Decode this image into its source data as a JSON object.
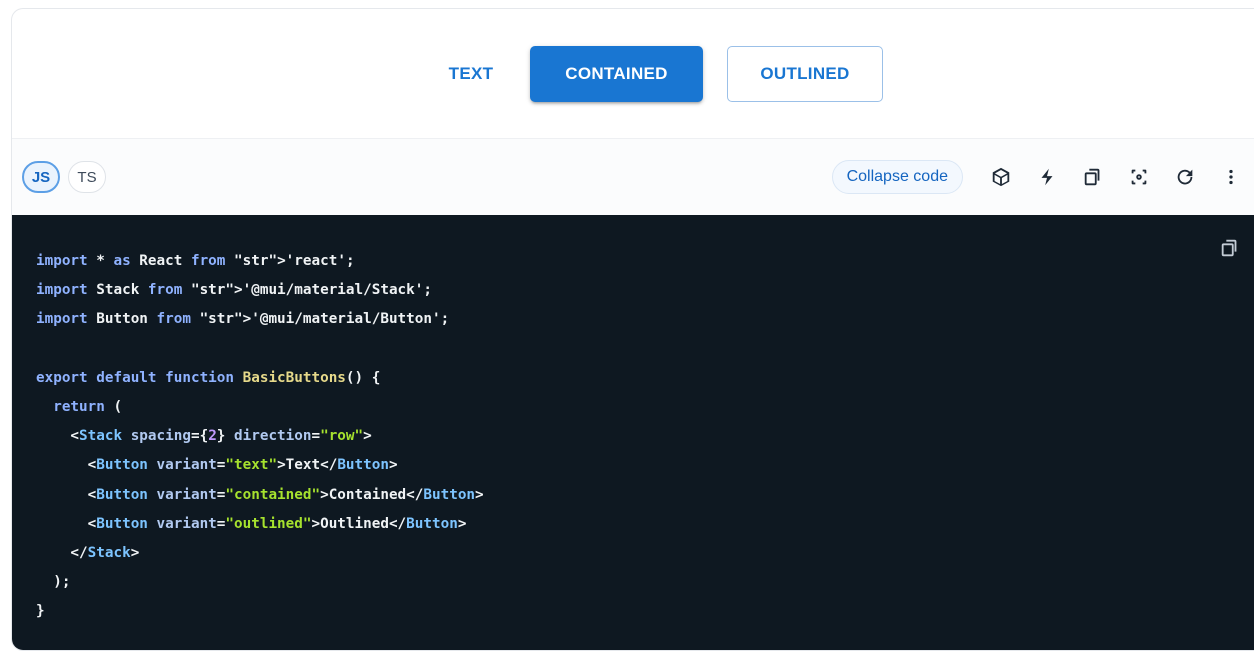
{
  "demo": {
    "buttons": [
      {
        "label": "Text"
      },
      {
        "label": "Contained"
      },
      {
        "label": "Outlined"
      }
    ]
  },
  "toolbar": {
    "languages": [
      "JS",
      "TS"
    ],
    "selected_language": "JS",
    "collapse_label": "Collapse code",
    "icons": [
      "codesandbox-icon",
      "stackblitz-icon",
      "copy-icon",
      "focus-icon",
      "reset-icon",
      "more-options-icon"
    ]
  },
  "code": {
    "lines": [
      "import * as React from 'react';",
      "import Stack from '@mui/material/Stack';",
      "import Button from '@mui/material/Button';",
      "",
      "export default function BasicButtons() {",
      "  return (",
      "    <Stack spacing={2} direction=\"row\">",
      "      <Button variant=\"text\">Text</Button>",
      "      <Button variant=\"contained\">Contained</Button>",
      "      <Button variant=\"outlined\">Outlined</Button>",
      "    </Stack>",
      "  );",
      "}"
    ]
  },
  "colors": {
    "primary": "#1976d2",
    "code_background": "#0e1821"
  }
}
